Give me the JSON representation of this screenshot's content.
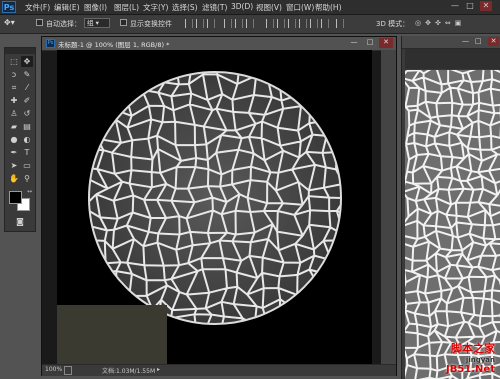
{
  "app": {
    "logo": "Ps"
  },
  "menu": [
    "文件(F)",
    "编辑(E)",
    "图像(I)",
    "图层(L)",
    "文字(Y)",
    "选择(S)",
    "滤镜(T)",
    "3D(D)",
    "视图(V)",
    "窗口(W)",
    "帮助(H)"
  ],
  "window_controls": {
    "minimize": "—",
    "maximize": "□",
    "close": "✕"
  },
  "options": {
    "auto_select_label": "自动选择：",
    "auto_select_value": "组",
    "transform_controls_label": "显示变换控件",
    "mode_3d": "3D 模式："
  },
  "document": {
    "title": "未标题-1 @ 100% (图层 1, RGB/8) *",
    "zoom": "100%",
    "doc_info": "文档:1.03M/1.55M"
  },
  "tools": [
    "move-icon",
    "marquee-icon",
    "lasso-icon",
    "quick-select-icon",
    "crop-icon",
    "eyedropper-icon",
    "healing-icon",
    "brush-icon",
    "stamp-icon",
    "history-brush-icon",
    "eraser-icon",
    "gradient-icon",
    "blur-icon",
    "dodge-icon",
    "pen-icon",
    "type-icon",
    "path-select-icon",
    "shape-icon",
    "hand-icon",
    "zoom-icon"
  ],
  "colors": {
    "foreground": "#000000",
    "background": "#ffffff"
  },
  "watermark": {
    "line1": "脚本之家",
    "line2": "jingyan",
    "line3": "JB51.Net"
  }
}
